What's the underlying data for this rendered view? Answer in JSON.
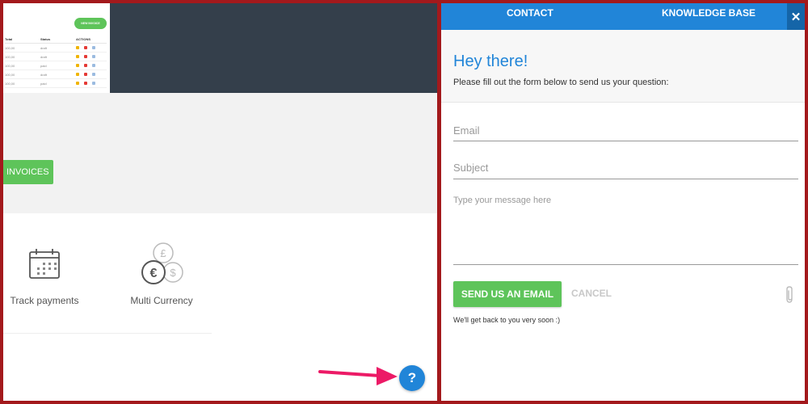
{
  "colors": {
    "frame": "#a3191c",
    "accent_blue": "#2185d8",
    "accent_green": "#5ec45a",
    "hero_dark": "#343f4b",
    "arrow_pink": "#ec1a66"
  },
  "left": {
    "mini_app": {
      "new_invoice_label": "NEW INVOICE",
      "headers": [
        "Total",
        "Status",
        "ACTIONS"
      ],
      "rows": [
        {
          "total": "100,00",
          "status": "draft"
        },
        {
          "total": "100,00",
          "status": "draft"
        },
        {
          "total": "100,00",
          "status": "paid"
        },
        {
          "total": "100,00",
          "status": "draft"
        },
        {
          "total": "100,00",
          "status": "paid"
        }
      ]
    },
    "invoices_label": "INVOICES",
    "features": [
      {
        "label": "Track payments",
        "icon": "calendar-icon"
      },
      {
        "label": "Multi Currency",
        "icon": "currency-coins-icon"
      }
    ],
    "help_label": "?"
  },
  "widget": {
    "tabs": [
      {
        "label": "CONTACT",
        "active": true
      },
      {
        "label": "KNOWLEDGE BASE",
        "active": false
      }
    ],
    "close_label": "✕",
    "greeting": "Hey there!",
    "subtitle": "Please fill out the form below to send us your question:",
    "email_placeholder": "Email",
    "subject_placeholder": "Subject",
    "message_placeholder": "Type your message here",
    "send_label": "SEND US AN EMAIL",
    "cancel_label": "CANCEL",
    "attachment_icon": "paperclip-icon",
    "note": "We'll get back to you very soon :)"
  }
}
